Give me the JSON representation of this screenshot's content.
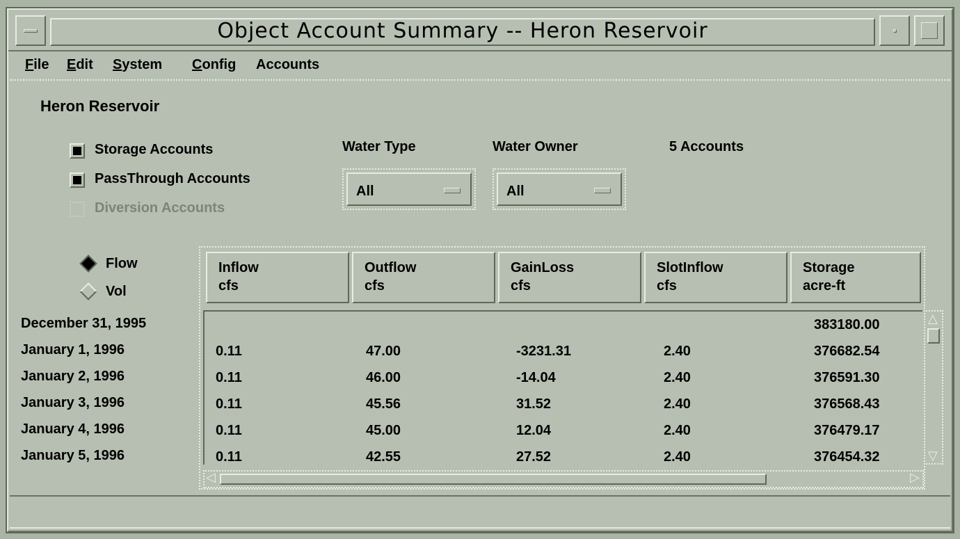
{
  "window": {
    "title": "Object Account Summary -- Heron Reservoir"
  },
  "menubar": {
    "items": [
      {
        "label": "File"
      },
      {
        "label": "Edit"
      },
      {
        "label": "System"
      },
      {
        "label": "Config"
      },
      {
        "label": "Accounts"
      }
    ]
  },
  "reservoir": "Heron Reservoir",
  "filters": {
    "storage_accounts": {
      "label": "Storage Accounts",
      "checked": true
    },
    "passthrough_accounts": {
      "label": "PassThrough Accounts",
      "checked": true
    },
    "diversion_accounts": {
      "label": "Diversion Accounts",
      "checked": false,
      "disabled": true
    },
    "water_type": {
      "heading": "Water Type",
      "value": "All"
    },
    "water_owner": {
      "heading": "Water Owner",
      "value": "All"
    },
    "account_count": "5 Accounts"
  },
  "mode": {
    "flow": {
      "label": "Flow",
      "selected": true
    },
    "vol": {
      "label": "Vol",
      "selected": false
    }
  },
  "table": {
    "columns": [
      {
        "name": "Inflow",
        "unit": "cfs"
      },
      {
        "name": "Outflow",
        "unit": "cfs"
      },
      {
        "name": "GainLoss",
        "unit": "cfs"
      },
      {
        "name": "SlotInflow",
        "unit": "cfs"
      },
      {
        "name": "Storage",
        "unit": "acre-ft"
      }
    ],
    "rows": [
      {
        "date": "December 31, 1995",
        "cells": [
          "",
          "",
          "",
          "",
          "383180.00"
        ]
      },
      {
        "date": "January 1, 1996",
        "cells": [
          "0.11",
          "47.00",
          "-3231.31",
          "2.40",
          "376682.54"
        ]
      },
      {
        "date": "January 2, 1996",
        "cells": [
          "0.11",
          "46.00",
          "-14.04",
          "2.40",
          "376591.30"
        ]
      },
      {
        "date": "January 3, 1996",
        "cells": [
          "0.11",
          "45.56",
          "31.52",
          "2.40",
          "376568.43"
        ]
      },
      {
        "date": "January 4, 1996",
        "cells": [
          "0.11",
          "45.00",
          "12.04",
          "2.40",
          "376479.17"
        ]
      },
      {
        "date": "January 5, 1996",
        "cells": [
          "0.11",
          "42.55",
          "27.52",
          "2.40",
          "376454.32"
        ]
      }
    ]
  }
}
